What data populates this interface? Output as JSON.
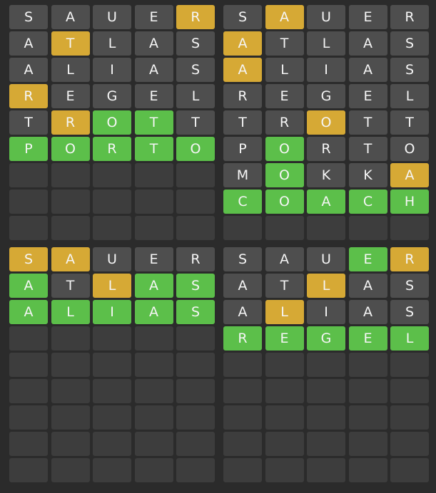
{
  "colors": {
    "background": "#2b2b2b",
    "absent": "#4e4e4e",
    "present": "#d6a935",
    "correct": "#5cbf4a",
    "empty": "#3d3d3d"
  },
  "total_rows": 9,
  "boards": [
    {
      "rows": [
        [
          [
            "S",
            "absent"
          ],
          [
            "A",
            "absent"
          ],
          [
            "U",
            "absent"
          ],
          [
            "E",
            "absent"
          ],
          [
            "R",
            "present"
          ]
        ],
        [
          [
            "A",
            "absent"
          ],
          [
            "T",
            "present"
          ],
          [
            "L",
            "absent"
          ],
          [
            "A",
            "absent"
          ],
          [
            "S",
            "absent"
          ]
        ],
        [
          [
            "A",
            "absent"
          ],
          [
            "L",
            "absent"
          ],
          [
            "I",
            "absent"
          ],
          [
            "A",
            "absent"
          ],
          [
            "S",
            "absent"
          ]
        ],
        [
          [
            "R",
            "present"
          ],
          [
            "E",
            "absent"
          ],
          [
            "G",
            "absent"
          ],
          [
            "E",
            "absent"
          ],
          [
            "L",
            "absent"
          ]
        ],
        [
          [
            "T",
            "absent"
          ],
          [
            "R",
            "present"
          ],
          [
            "O",
            "correct"
          ],
          [
            "T",
            "correct"
          ],
          [
            "T",
            "absent"
          ]
        ],
        [
          [
            "P",
            "correct"
          ],
          [
            "O",
            "correct"
          ],
          [
            "R",
            "correct"
          ],
          [
            "T",
            "correct"
          ],
          [
            "O",
            "correct"
          ]
        ]
      ]
    },
    {
      "rows": [
        [
          [
            "S",
            "absent"
          ],
          [
            "A",
            "present"
          ],
          [
            "U",
            "absent"
          ],
          [
            "E",
            "absent"
          ],
          [
            "R",
            "absent"
          ]
        ],
        [
          [
            "A",
            "present"
          ],
          [
            "T",
            "absent"
          ],
          [
            "L",
            "absent"
          ],
          [
            "A",
            "absent"
          ],
          [
            "S",
            "absent"
          ]
        ],
        [
          [
            "A",
            "present"
          ],
          [
            "L",
            "absent"
          ],
          [
            "I",
            "absent"
          ],
          [
            "A",
            "absent"
          ],
          [
            "S",
            "absent"
          ]
        ],
        [
          [
            "R",
            "absent"
          ],
          [
            "E",
            "absent"
          ],
          [
            "G",
            "absent"
          ],
          [
            "E",
            "absent"
          ],
          [
            "L",
            "absent"
          ]
        ],
        [
          [
            "T",
            "absent"
          ],
          [
            "R",
            "absent"
          ],
          [
            "O",
            "present"
          ],
          [
            "T",
            "absent"
          ],
          [
            "T",
            "absent"
          ]
        ],
        [
          [
            "P",
            "absent"
          ],
          [
            "O",
            "correct"
          ],
          [
            "R",
            "absent"
          ],
          [
            "T",
            "absent"
          ],
          [
            "O",
            "absent"
          ]
        ],
        [
          [
            "M",
            "absent"
          ],
          [
            "O",
            "correct"
          ],
          [
            "K",
            "absent"
          ],
          [
            "K",
            "absent"
          ],
          [
            "A",
            "present"
          ]
        ],
        [
          [
            "C",
            "correct"
          ],
          [
            "O",
            "correct"
          ],
          [
            "A",
            "correct"
          ],
          [
            "C",
            "correct"
          ],
          [
            "H",
            "correct"
          ]
        ]
      ]
    },
    {
      "rows": [
        [
          [
            "S",
            "present"
          ],
          [
            "A",
            "present"
          ],
          [
            "U",
            "absent"
          ],
          [
            "E",
            "absent"
          ],
          [
            "R",
            "absent"
          ]
        ],
        [
          [
            "A",
            "correct"
          ],
          [
            "T",
            "absent"
          ],
          [
            "L",
            "present"
          ],
          [
            "A",
            "correct"
          ],
          [
            "S",
            "correct"
          ]
        ],
        [
          [
            "A",
            "correct"
          ],
          [
            "L",
            "correct"
          ],
          [
            "I",
            "correct"
          ],
          [
            "A",
            "correct"
          ],
          [
            "S",
            "correct"
          ]
        ]
      ]
    },
    {
      "rows": [
        [
          [
            "S",
            "absent"
          ],
          [
            "A",
            "absent"
          ],
          [
            "U",
            "absent"
          ],
          [
            "E",
            "correct"
          ],
          [
            "R",
            "present"
          ]
        ],
        [
          [
            "A",
            "absent"
          ],
          [
            "T",
            "absent"
          ],
          [
            "L",
            "present"
          ],
          [
            "A",
            "absent"
          ],
          [
            "S",
            "absent"
          ]
        ],
        [
          [
            "A",
            "absent"
          ],
          [
            "L",
            "present"
          ],
          [
            "I",
            "absent"
          ],
          [
            "A",
            "absent"
          ],
          [
            "S",
            "absent"
          ]
        ],
        [
          [
            "R",
            "correct"
          ],
          [
            "E",
            "correct"
          ],
          [
            "G",
            "correct"
          ],
          [
            "E",
            "correct"
          ],
          [
            "L",
            "correct"
          ]
        ]
      ]
    }
  ]
}
